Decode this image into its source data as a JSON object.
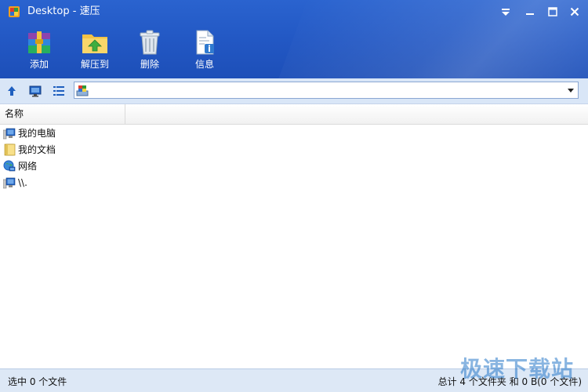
{
  "window": {
    "title": "Desktop - 速压"
  },
  "toolbar": {
    "add_label": "添加",
    "extract_label": "解压到",
    "delete_label": "删除",
    "info_label": "信息"
  },
  "navigation": {
    "address_value": ""
  },
  "list": {
    "columns": [
      "名称"
    ],
    "items": [
      {
        "name": "我的电脑",
        "icon": "computer-icon"
      },
      {
        "name": "我的文档",
        "icon": "documents-folder-icon"
      },
      {
        "name": "网络",
        "icon": "network-icon"
      },
      {
        "name": "\\\\.",
        "icon": "computer-icon"
      }
    ]
  },
  "status": {
    "left": "选中 0 个文件",
    "right": "总计 4 个文件夹 和 0 B(0 个文件)"
  },
  "watermark": {
    "text": "极速下载站"
  },
  "colors": {
    "title_blue": "#2257c3",
    "nav_bg": "#d9e6f7",
    "status_bg": "#dde8f6"
  }
}
